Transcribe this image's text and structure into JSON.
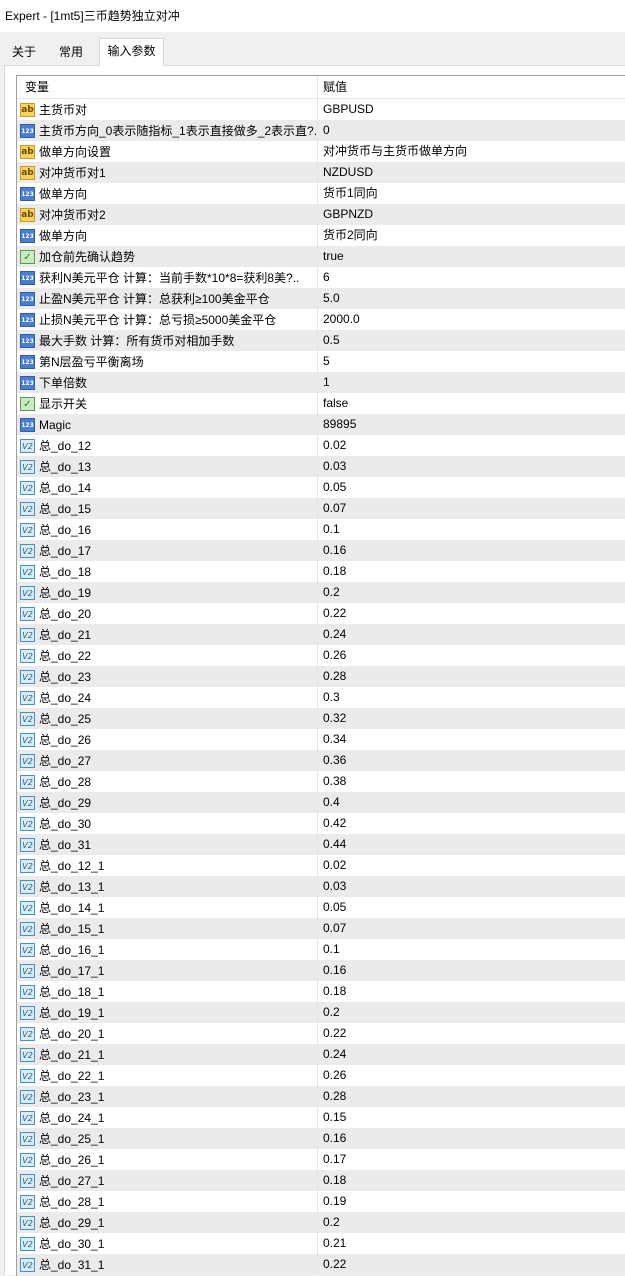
{
  "window": {
    "title": "Expert - [1mt5]三币趋势独立对冲"
  },
  "tabs": [
    {
      "label": "关于",
      "active": false
    },
    {
      "label": "常用",
      "active": false
    },
    {
      "label": "输入参数",
      "active": true
    }
  ],
  "grid": {
    "header": {
      "variable": "变量",
      "value": "赋值"
    },
    "rows": [
      {
        "name": "主货币对",
        "value": "GBPUSD",
        "icon": "string-icon"
      },
      {
        "name": "主货币方向_0表示随指标_1表示直接做多_2表示直?..",
        "value": "0",
        "icon": "integer-icon"
      },
      {
        "name": "做单方向设置",
        "value": "对冲货币与主货币做单方向",
        "icon": "string-icon"
      },
      {
        "name": "对冲货币对1",
        "value": "NZDUSD",
        "icon": "string-icon"
      },
      {
        "name": "做单方向",
        "value": "货币1同向",
        "icon": "integer-icon"
      },
      {
        "name": "对冲货币对2",
        "value": "GBPNZD",
        "icon": "string-icon"
      },
      {
        "name": "做单方向",
        "value": "货币2同向",
        "icon": "integer-icon"
      },
      {
        "name": "加仓前先确认趋势",
        "value": "true",
        "icon": "bool-icon"
      },
      {
        "name": "获利N美元平仓  计算：当前手数*10*8=获利8美?..",
        "value": "6",
        "icon": "integer-icon"
      },
      {
        "name": "止盈N美元平仓  计算：总获利≥100美金平仓",
        "value": "5.0",
        "icon": "integer-icon"
      },
      {
        "name": "止损N美元平仓  计算：总亏损≥5000美金平仓",
        "value": "2000.0",
        "icon": "integer-icon"
      },
      {
        "name": "最大手数            计算：所有货币对相加手数",
        "value": "0.5",
        "icon": "integer-icon"
      },
      {
        "name": "第N层盈亏平衡离场",
        "value": "5",
        "icon": "integer-icon"
      },
      {
        "name": "下单倍数",
        "value": "1",
        "icon": "integer-icon"
      },
      {
        "name": "显示开关",
        "value": "false",
        "icon": "bool-icon"
      },
      {
        "name": "Magic",
        "value": "89895",
        "icon": "integer-icon"
      },
      {
        "name": "总_do_12",
        "value": "0.02",
        "icon": "double-icon"
      },
      {
        "name": "总_do_13",
        "value": "0.03",
        "icon": "double-icon"
      },
      {
        "name": "总_do_14",
        "value": "0.05",
        "icon": "double-icon"
      },
      {
        "name": "总_do_15",
        "value": "0.07",
        "icon": "double-icon"
      },
      {
        "name": "总_do_16",
        "value": "0.1",
        "icon": "double-icon"
      },
      {
        "name": "总_do_17",
        "value": "0.16",
        "icon": "double-icon"
      },
      {
        "name": "总_do_18",
        "value": "0.18",
        "icon": "double-icon"
      },
      {
        "name": "总_do_19",
        "value": "0.2",
        "icon": "double-icon"
      },
      {
        "name": "总_do_20",
        "value": "0.22",
        "icon": "double-icon"
      },
      {
        "name": "总_do_21",
        "value": "0.24",
        "icon": "double-icon"
      },
      {
        "name": "总_do_22",
        "value": "0.26",
        "icon": "double-icon"
      },
      {
        "name": "总_do_23",
        "value": "0.28",
        "icon": "double-icon"
      },
      {
        "name": "总_do_24",
        "value": "0.3",
        "icon": "double-icon"
      },
      {
        "name": "总_do_25",
        "value": "0.32",
        "icon": "double-icon"
      },
      {
        "name": "总_do_26",
        "value": "0.34",
        "icon": "double-icon"
      },
      {
        "name": "总_do_27",
        "value": "0.36",
        "icon": "double-icon"
      },
      {
        "name": "总_do_28",
        "value": "0.38",
        "icon": "double-icon"
      },
      {
        "name": "总_do_29",
        "value": "0.4",
        "icon": "double-icon"
      },
      {
        "name": "总_do_30",
        "value": "0.42",
        "icon": "double-icon"
      },
      {
        "name": "总_do_31",
        "value": "0.44",
        "icon": "double-icon"
      },
      {
        "name": "总_do_12_1",
        "value": "0.02",
        "icon": "double-icon"
      },
      {
        "name": "总_do_13_1",
        "value": "0.03",
        "icon": "double-icon"
      },
      {
        "name": "总_do_14_1",
        "value": "0.05",
        "icon": "double-icon"
      },
      {
        "name": "总_do_15_1",
        "value": "0.07",
        "icon": "double-icon"
      },
      {
        "name": "总_do_16_1",
        "value": "0.1",
        "icon": "double-icon"
      },
      {
        "name": "总_do_17_1",
        "value": "0.16",
        "icon": "double-icon"
      },
      {
        "name": "总_do_18_1",
        "value": "0.18",
        "icon": "double-icon"
      },
      {
        "name": "总_do_19_1",
        "value": "0.2",
        "icon": "double-icon"
      },
      {
        "name": "总_do_20_1",
        "value": "0.22",
        "icon": "double-icon"
      },
      {
        "name": "总_do_21_1",
        "value": "0.24",
        "icon": "double-icon"
      },
      {
        "name": "总_do_22_1",
        "value": "0.26",
        "icon": "double-icon"
      },
      {
        "name": "总_do_23_1",
        "value": "0.28",
        "icon": "double-icon"
      },
      {
        "name": "总_do_24_1",
        "value": "0.15",
        "icon": "double-icon"
      },
      {
        "name": "总_do_25_1",
        "value": "0.16",
        "icon": "double-icon"
      },
      {
        "name": "总_do_26_1",
        "value": "0.17",
        "icon": "double-icon"
      },
      {
        "name": "总_do_27_1",
        "value": "0.18",
        "icon": "double-icon"
      },
      {
        "name": "总_do_28_1",
        "value": "0.19",
        "icon": "double-icon"
      },
      {
        "name": "总_do_29_1",
        "value": "0.2",
        "icon": "double-icon"
      },
      {
        "name": "总_do_30_1",
        "value": "0.21",
        "icon": "double-icon"
      },
      {
        "name": "总_do_31_1",
        "value": "0.22",
        "icon": "double-icon"
      }
    ]
  }
}
